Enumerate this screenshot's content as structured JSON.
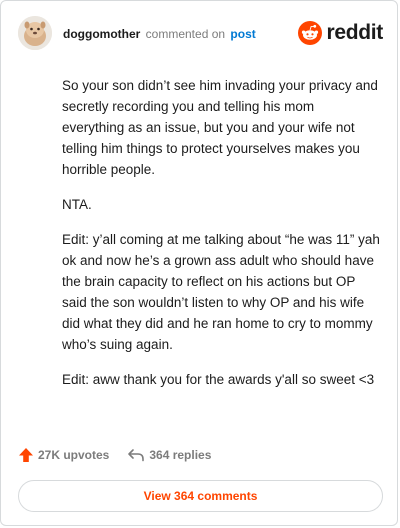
{
  "header": {
    "username": "doggomother",
    "action_text": "commented on",
    "post_link": "post",
    "brand": "reddit"
  },
  "comment": {
    "paragraphs": [
      "So your son didn’t see him invading your privacy and secretly recording you and telling his mom everything as an issue, but you and your wife not telling him things to protect yourselves makes you horrible people.",
      "NTA.",
      "Edit: y’all coming at me talking about “he was 11” yah ok and now he’s a grown ass adult who should have the brain capacity to reflect on his actions but OP said the son wouldn’t listen to why OP and his wife did what they did and he ran home to cry to mommy who’s suing again.",
      "Edit: aww thank you for the awards y'all so sweet <3"
    ]
  },
  "actions": {
    "upvotes": "27K upvotes",
    "replies": "364 replies"
  },
  "footer": {
    "view_comments": "View 364 comments"
  },
  "colors": {
    "brand_orange": "#ff4500",
    "link_blue": "#0079d3",
    "muted": "#7c7c7c",
    "text": "#1c1c1c"
  },
  "icons": {
    "upvote": "upvote-arrow-icon",
    "reply": "reply-arrow-icon",
    "brand": "reddit-snoo-icon"
  }
}
